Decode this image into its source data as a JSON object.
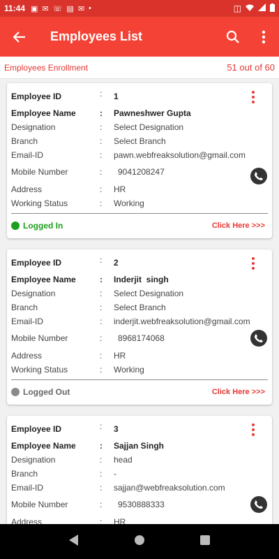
{
  "status_bar": {
    "time": "11:44"
  },
  "app_bar": {
    "title": "Employees List"
  },
  "sub_bar": {
    "left_label": "Employees Enrollment",
    "count": "51 out of 60"
  },
  "labels": {
    "employee_id": "Employee ID",
    "employee_name": "Employee Name",
    "designation": "Designation",
    "branch": "Branch",
    "email": "Email-ID",
    "mobile": "Mobile Number",
    "address": "Address",
    "working_status": "Working Status",
    "colon": ":",
    "click_here": "Click Here >>>"
  },
  "employees": [
    {
      "id": "1",
      "name": "Pawneshwer Gupta",
      "designation": "Select Designation",
      "branch": "Select Branch",
      "email": "pawn.webfreaksolution@gmail.com",
      "mobile": "9041208247",
      "address": "HR",
      "working_status": "Working",
      "login_status": "Logged In",
      "login_color": "#1e9e1e"
    },
    {
      "id": "2",
      "name": "Inderjit  singh",
      "designation": "Select Designation",
      "branch": "Select Branch",
      "email": "inderjit.webfreaksolution@gmail.com",
      "mobile": "8968174068",
      "address": "HR",
      "working_status": "Working",
      "login_status": "Logged Out",
      "login_color": "#8a8a8a"
    },
    {
      "id": "3",
      "name": "Sajjan Singh",
      "designation": "head",
      "branch": "-",
      "email": "sajjan@webfreaksolution.com",
      "mobile": "9530888333",
      "address": "HR"
    }
  ],
  "colors": {
    "primary": "#f44336",
    "status_bar": "#d9332c",
    "accent": "#e53935"
  }
}
